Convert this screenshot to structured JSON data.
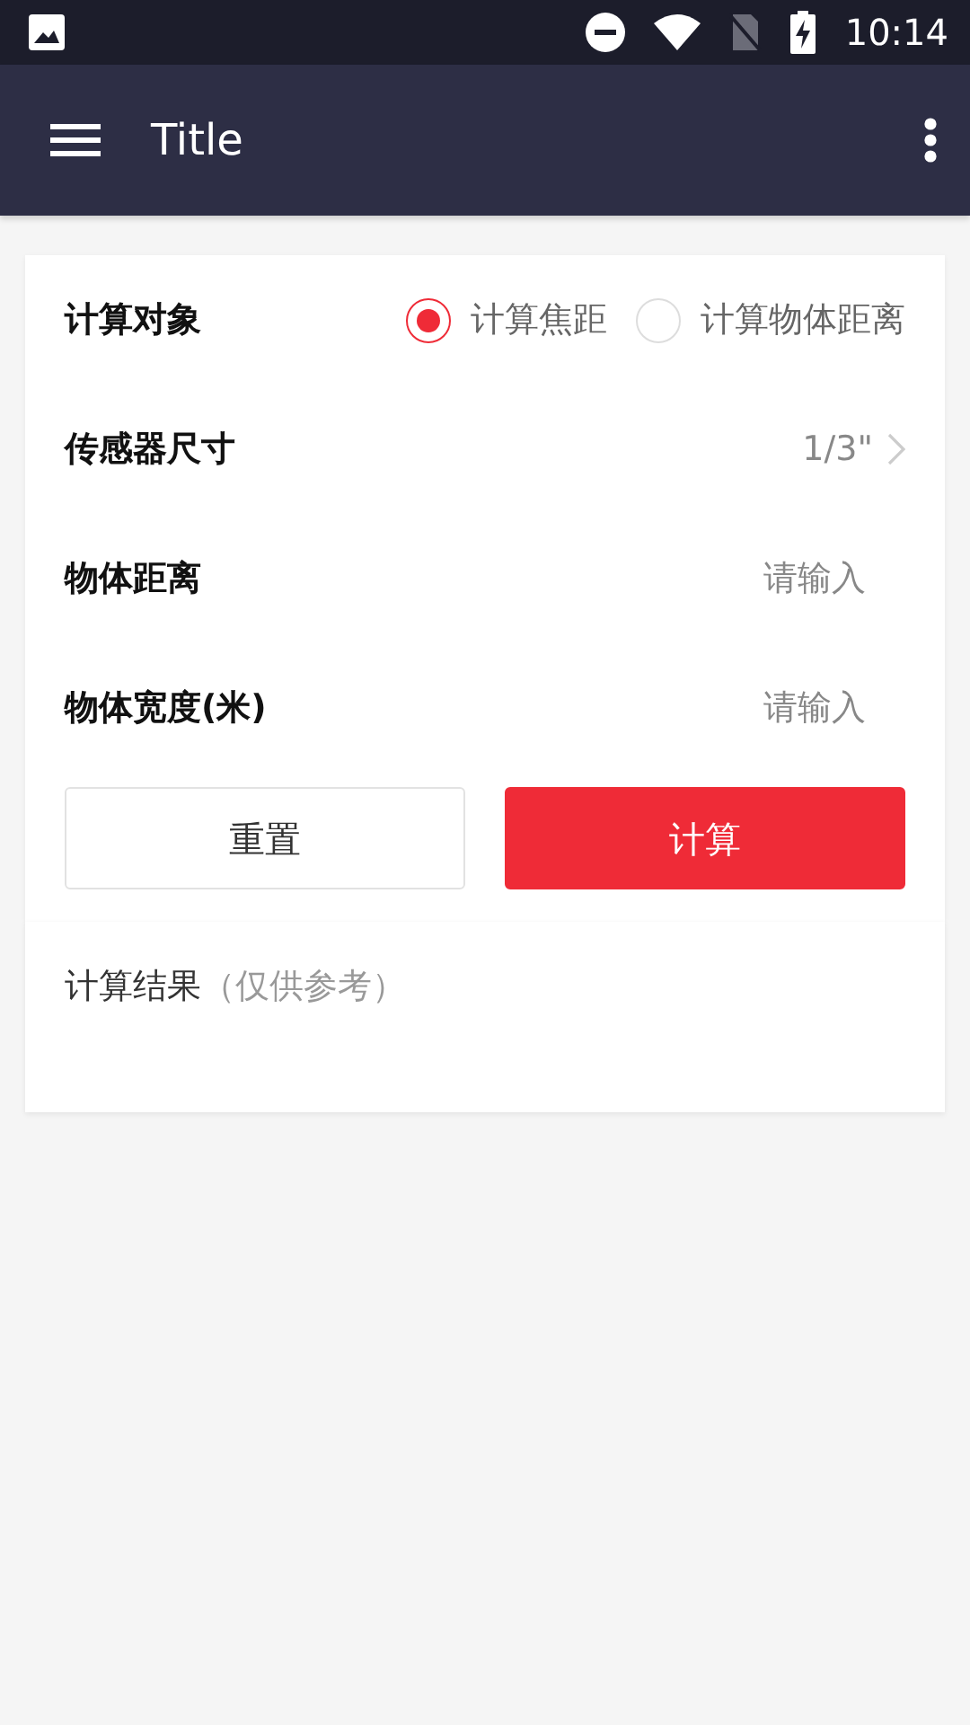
{
  "status_bar": {
    "time": "10:14"
  },
  "app_bar": {
    "title": "Title"
  },
  "form": {
    "rows": [
      {
        "kind": "radio",
        "label": "计算对象",
        "options": [
          {
            "label": "计算焦距",
            "selected": true
          },
          {
            "label": "计算物体距离",
            "selected": false
          }
        ]
      },
      {
        "kind": "select",
        "label": "传感器尺寸",
        "value": "1/3\""
      },
      {
        "kind": "input",
        "label": "物体距离",
        "placeholder": "请输入"
      },
      {
        "kind": "input",
        "label": "物体宽度(米)",
        "placeholder": "请输入"
      }
    ],
    "buttons": [
      {
        "label": "重置",
        "kind": "secondary"
      },
      {
        "label": "计算",
        "kind": "primary"
      }
    ]
  },
  "result": {
    "label": "计算结果",
    "note": "（仅供参考）"
  }
}
